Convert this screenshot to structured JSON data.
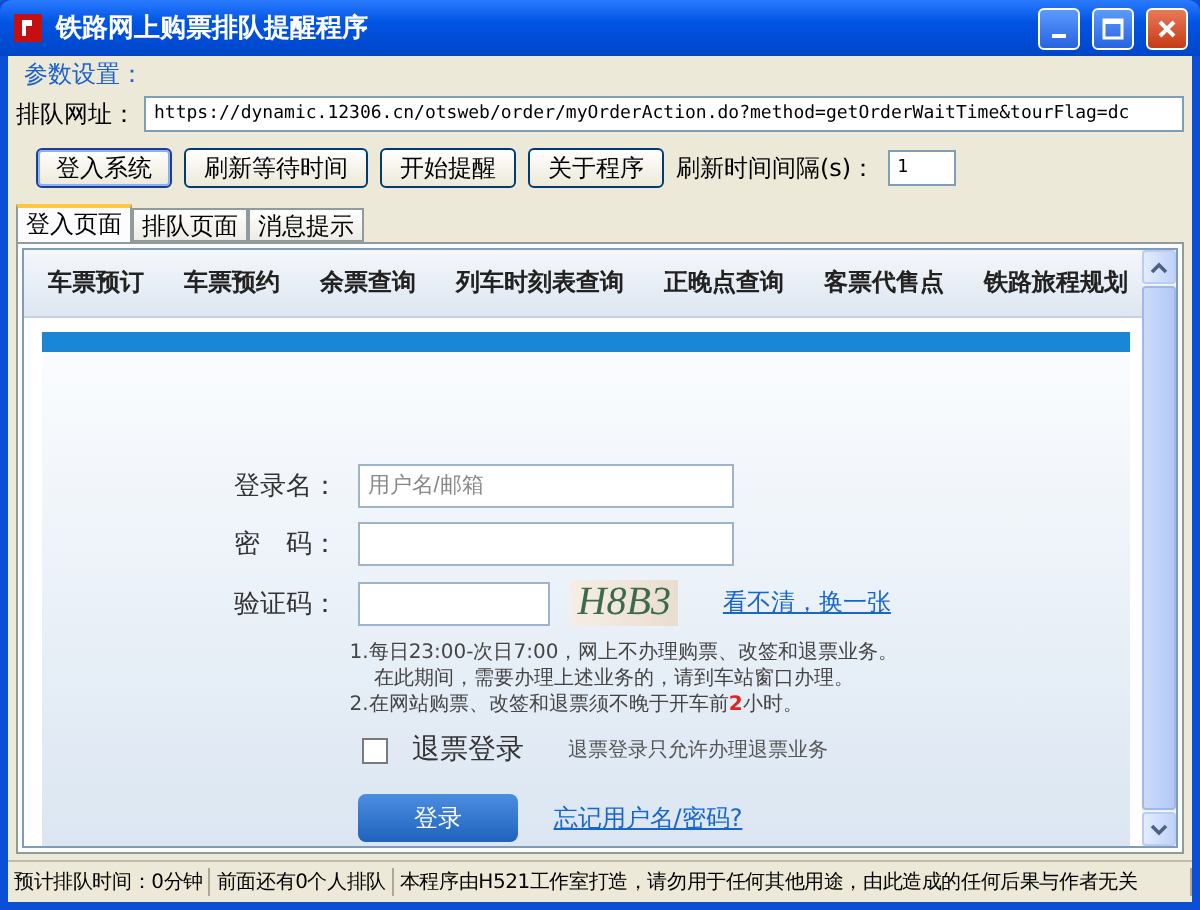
{
  "window": {
    "title": "铁路网上购票排队提醒程序"
  },
  "settings": {
    "group_label": "参数设置：",
    "url_label": "排队网址：",
    "url": "https://dynamic.12306.cn/otsweb/order/myOrderAction.do?method=getOrderWaitTime&tourFlag=dc",
    "buttons": [
      {
        "label": "登入系统",
        "selected": true
      },
      {
        "label": "刷新等待时间",
        "selected": false
      },
      {
        "label": "开始提醒",
        "selected": false
      },
      {
        "label": "关于程序",
        "selected": false
      }
    ],
    "interval_label": "刷新时间间隔(s)：",
    "interval": "1"
  },
  "tabs": [
    {
      "label": "登入页面",
      "selected": true
    },
    {
      "label": "排队页面",
      "selected": false
    },
    {
      "label": "消息提示",
      "selected": false
    }
  ],
  "browser": {
    "nav": [
      "车票预订",
      "车票预约",
      "余票查询",
      "列车时刻表查询",
      "正晚点查询",
      "客票代售点",
      "铁路旅程规划"
    ],
    "login": {
      "username_label": "登录名：",
      "username_placeholder": "用户名/邮箱",
      "password_label": "密　码：",
      "captcha_label": "验证码：",
      "captcha": "H8B3",
      "refresh_link": "看不清，换一张",
      "notes": [
        "1.每日23:00-次日7:00，网上不办理购票、改签和退票业务。",
        "在此期间，需要办理上述业务的，请到车站窗口办理。",
        "2.在网站购票、改签和退票须不晚于开车前**2**小时。"
      ],
      "refund_login": {
        "label": "退票登录",
        "checked": false,
        "hint": "退票登录只允许办理退票业务"
      },
      "submit": "登录",
      "forgot_link": "忘记用户名/密码?"
    }
  },
  "status_bar": [
    "预计排队时间：0分钟",
    "前面还有0个人排队",
    "本程序由H521工作室打造，请勿用于任何其他用途，由此造成的任何后果与作者无关"
  ]
}
